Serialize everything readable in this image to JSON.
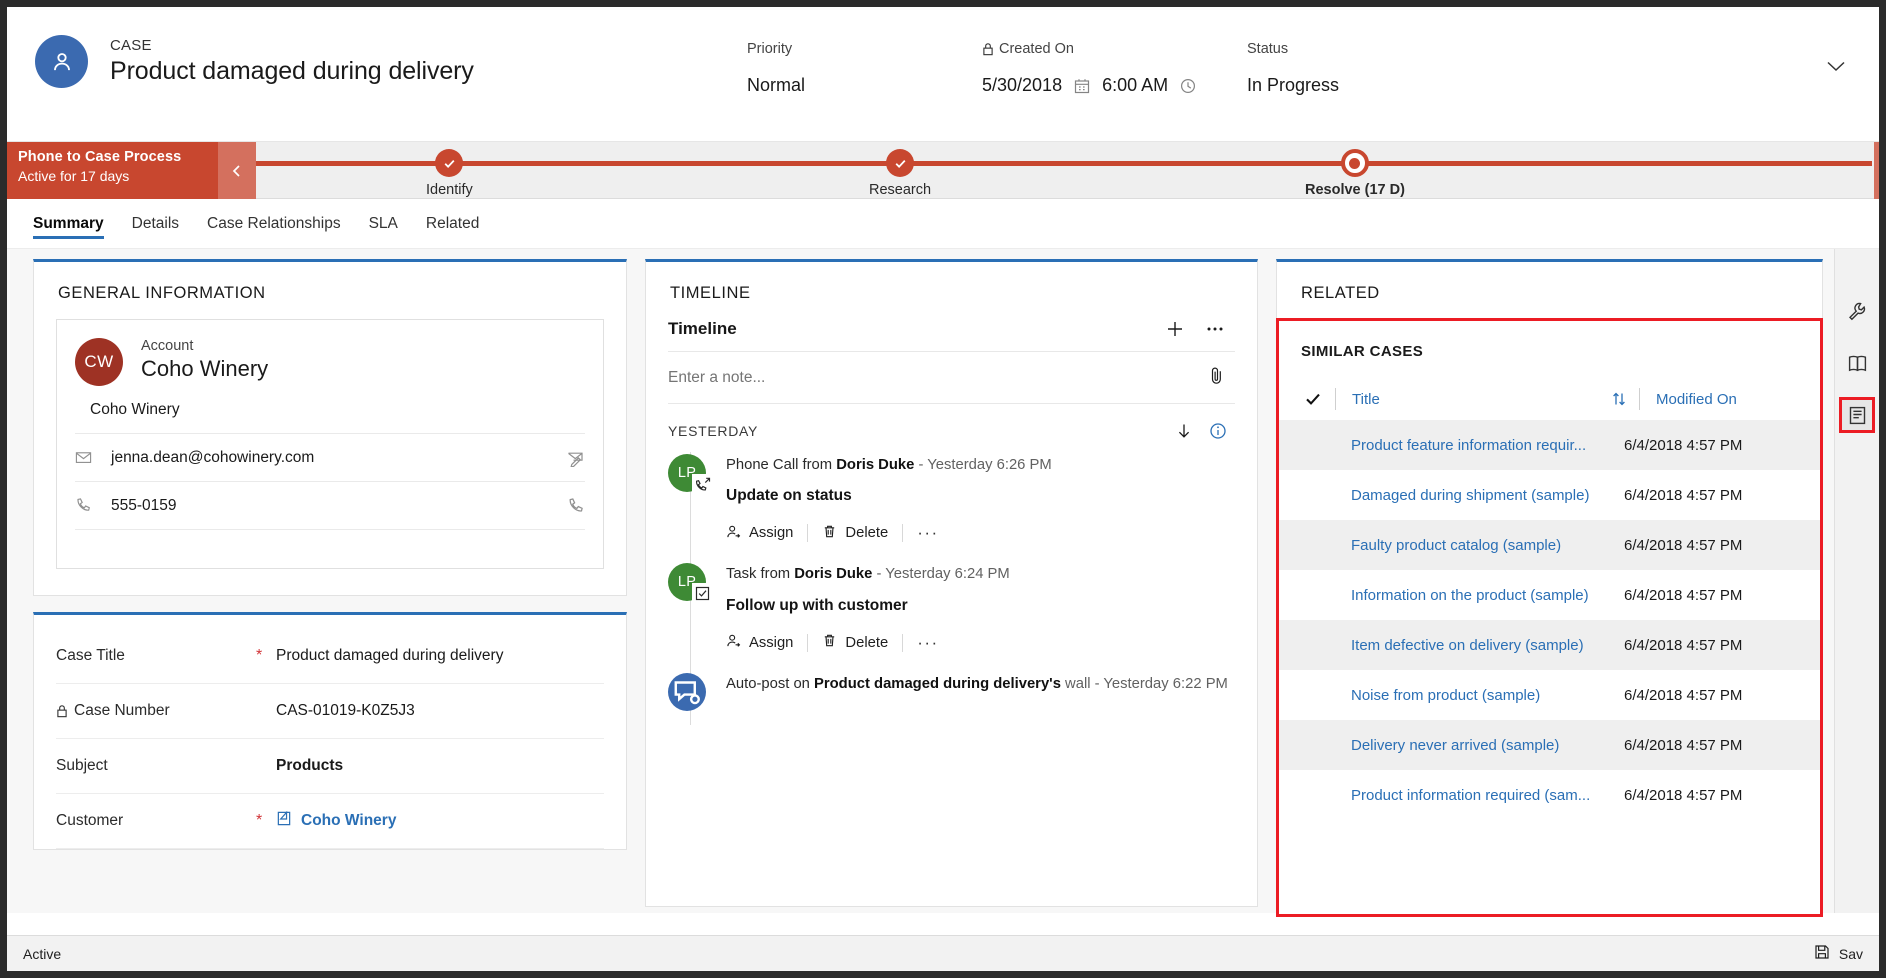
{
  "header": {
    "entity_kicker": "CASE",
    "record_title": "Product damaged during delivery",
    "avatar_icon": "person-icon",
    "expand_icon": "chevron-down-icon",
    "fields": [
      {
        "label": "Priority",
        "value": "Normal",
        "locked": false
      },
      {
        "label": "Created On",
        "value": "5/30/2018",
        "value2": "6:00 AM",
        "locked": true
      },
      {
        "label": "Status",
        "value": "In Progress",
        "locked": false
      }
    ]
  },
  "process": {
    "name": "Phone to Case Process",
    "subtitle": "Active for 17 days",
    "collapse_icon": "chevron-left-icon",
    "stages": [
      {
        "label": "Identify",
        "state": "complete"
      },
      {
        "label": "Research",
        "state": "complete"
      },
      {
        "label": "Resolve  (17 D)",
        "state": "current"
      }
    ]
  },
  "tabs": [
    {
      "label": "Summary",
      "active": true
    },
    {
      "label": "Details",
      "active": false
    },
    {
      "label": "Case Relationships",
      "active": false
    },
    {
      "label": "SLA",
      "active": false
    },
    {
      "label": "Related",
      "active": false
    }
  ],
  "general_information": {
    "section_title": "GENERAL INFORMATION",
    "quick_view": {
      "avatar_initials": "CW",
      "entity_label": "Account",
      "entity_name": "Coho Winery",
      "rows": [
        {
          "icon": "",
          "value": "Coho Winery",
          "trailing_icon": ""
        },
        {
          "icon": "mail-icon",
          "value": "jenna.dean@cohowinery.com",
          "trailing_icon": "compose-mail-icon"
        },
        {
          "icon": "phone-icon",
          "value": "555-0159",
          "trailing_icon": "call-icon"
        }
      ]
    },
    "fields": [
      {
        "label": "Case Title",
        "required": true,
        "locked": false,
        "value": "Product damaged during delivery",
        "style": "plain"
      },
      {
        "label": "Case Number",
        "required": false,
        "locked": true,
        "value": "CAS-01019-K0Z5J3",
        "style": "plain"
      },
      {
        "label": "Subject",
        "required": false,
        "locked": false,
        "value": "Products",
        "style": "bold"
      },
      {
        "label": "Customer",
        "required": true,
        "locked": false,
        "value": "Coho Winery",
        "style": "link"
      }
    ]
  },
  "timeline": {
    "section_title": "TIMELINE",
    "panel_name": "Timeline",
    "add_icon": "plus-icon",
    "more_icon": "ellipsis-icon",
    "note_placeholder": "Enter a note...",
    "attach_icon": "paperclip-icon",
    "day_group": "YESTERDAY",
    "sort_icon": "arrow-down-icon",
    "info_icon": "info-icon",
    "action_assign": "Assign",
    "action_delete": "Delete",
    "action_more": "···",
    "items": [
      {
        "avatar_initials": "LP",
        "avatar_color": "green",
        "badge_icon": "phone-outgoing-icon",
        "prefix": "Phone Call from ",
        "actor": "Doris Duke",
        "time": " -  Yesterday 6:26 PM",
        "subject": "Update on status",
        "has_actions": true
      },
      {
        "avatar_initials": "LP",
        "avatar_color": "green",
        "badge_icon": "task-checkbox-icon",
        "prefix": "Task from ",
        "actor": "Doris Duke",
        "time": " -  Yesterday 6:24 PM",
        "subject": "Follow up with customer",
        "has_actions": true
      },
      {
        "avatar_initials": "",
        "avatar_color": "blue",
        "badge_icon": "auto-post-icon",
        "prefix": "Auto-post on ",
        "actor": "Product damaged during delivery's",
        "time": " wall -  Yesterday 6:22 PM",
        "subject": "",
        "has_actions": false
      }
    ]
  },
  "related": {
    "section_title": "RELATED",
    "similar_cases": {
      "title": "SIMILAR CASES",
      "select_all_icon": "checkmark-icon",
      "sort_icon": "sort-arrows-icon",
      "columns": [
        "Title",
        "Modified On"
      ],
      "rows": [
        {
          "title": "Product feature information requir...",
          "modified": "6/4/2018 4:57 PM"
        },
        {
          "title": "Damaged during shipment (sample)",
          "modified": "6/4/2018 4:57 PM"
        },
        {
          "title": "Faulty product catalog (sample)",
          "modified": "6/4/2018 4:57 PM"
        },
        {
          "title": "Information on the product (sample)",
          "modified": "6/4/2018 4:57 PM"
        },
        {
          "title": "Item defective on delivery (sample)",
          "modified": "6/4/2018 4:57 PM"
        },
        {
          "title": "Noise from product (sample)",
          "modified": "6/4/2018 4:57 PM"
        },
        {
          "title": "Delivery never arrived (sample)",
          "modified": "6/4/2018 4:57 PM"
        },
        {
          "title": "Product information required (sam...",
          "modified": "6/4/2018 4:57 PM"
        }
      ]
    }
  },
  "rail": [
    {
      "icon": "wrench-icon",
      "selected": false
    },
    {
      "icon": "book-icon",
      "selected": false
    },
    {
      "icon": "related-records-icon",
      "selected": true
    }
  ],
  "footer": {
    "status": "Active",
    "save_label": "Sav",
    "save_icon": "save-icon"
  },
  "colors": {
    "accent_blue": "#2a6fb5",
    "process_red": "#c8472f",
    "highlight_red": "#ec1c24",
    "avatar_blue": "#3b6ab0",
    "avatar_maroon": "#9e3224",
    "avatar_green": "#3e8a35",
    "required_red": "#d13438"
  }
}
